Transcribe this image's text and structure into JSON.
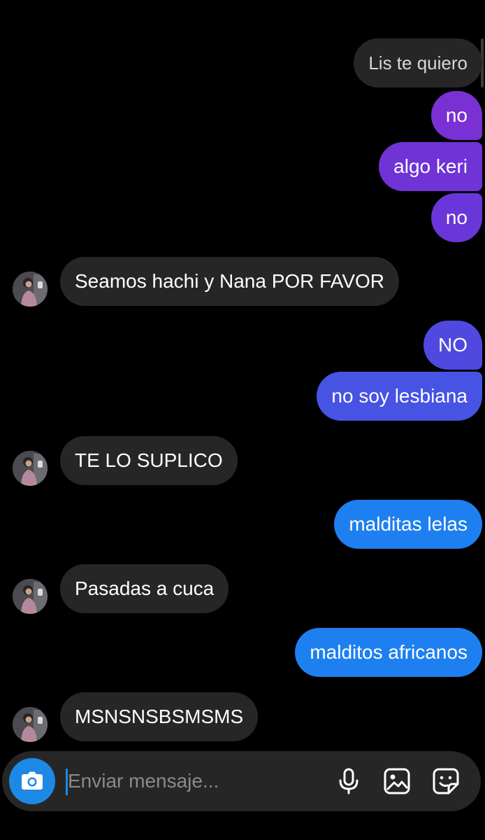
{
  "thread": {
    "messages": [
      {
        "side": "out",
        "text": "Lis te quiero",
        "color": "#262626"
      },
      {
        "side": "out",
        "text": "no",
        "color": "#7a31d3"
      },
      {
        "side": "out",
        "text": "algo keri",
        "color": "#7033d6"
      },
      {
        "side": "out",
        "text": "no",
        "color": "#6a36d9"
      },
      {
        "side": "in",
        "text": "Seamos hachi y Nana POR FAVOR"
      },
      {
        "side": "out",
        "text": "NO",
        "color": "#4f49e0"
      },
      {
        "side": "out",
        "text": "no soy lesbiana",
        "color": "#4753e3"
      },
      {
        "side": "in",
        "text": "TE LO SUPLICO"
      },
      {
        "side": "out",
        "text": "malditas lelas",
        "color": "#1e7ff0"
      },
      {
        "side": "in",
        "text": "Pasadas a cuca"
      },
      {
        "side": "out",
        "text": "malditos africanos",
        "color": "#1e80f0"
      },
      {
        "side": "in",
        "text": "MSNSNSBSMSMS"
      }
    ]
  },
  "composer": {
    "placeholder": "Enviar mensaje...",
    "icons": [
      "camera-icon",
      "microphone-icon",
      "gallery-icon",
      "sticker-icon"
    ],
    "accent": "#1e88e5"
  }
}
